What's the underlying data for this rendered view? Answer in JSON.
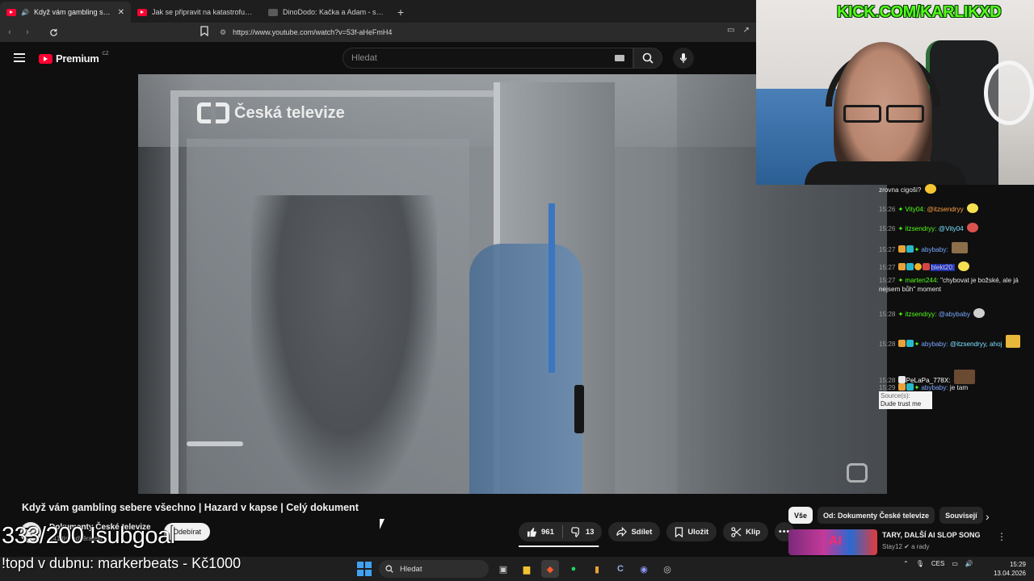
{
  "browser": {
    "tabs": [
      {
        "label": "Když vám gambling sebere v",
        "active": true
      },
      {
        "label": "Jak se připravit na katastrofu? | What",
        "active": false
      },
      {
        "label": "DinoDodo: Kačka a Adam - sourozen",
        "active": false
      }
    ],
    "new_tab": "+",
    "url": "https://www.youtube.com/watch?v=53f-aHeFmH4"
  },
  "youtube": {
    "logo_text": "Premium",
    "logo_region": "CZ",
    "search_placeholder": "Hledat",
    "video_watermark": "Česká televize",
    "video_corner_text": "ČESKÁ TELEVIZE",
    "video_title": "Když vám gambling sebere všechno | Hazard v kapse | Celý dokument",
    "channel_name": "Dokumenty České televize",
    "channel_subs": "141 tis. odběratelů",
    "subscribe_label": "Odebírat",
    "likes": "961",
    "dislikes": "13",
    "like_ratio": 0.99,
    "share_label": "Sdílet",
    "save_label": "Uložit",
    "clip_label": "Klip",
    "more_label": "•••",
    "chips": [
      "Vše",
      "Od: Dokumenty České televize",
      "Souvisejí"
    ],
    "chip_next": "›",
    "recommendation": {
      "title": "TARY, DALŠÍ AI SLOP SONG",
      "channel": "Stay12",
      "channel_suffix": "a rady",
      "thumb_text": "AI"
    }
  },
  "stream": {
    "kick_url": "KICK.COM/KARLIKXD",
    "subgoal": "333/200 !subgoal",
    "ticker": "!topd v dubnu: markerbeats - Kč1000",
    "chat": [
      {
        "ts": "",
        "user": "",
        "text": "zrovna cigoši?",
        "user_color": "#ffffff"
      },
      {
        "ts": "15:26",
        "user": "Vity04:",
        "text": "@itzsendryy",
        "user_color": "#53fc18",
        "mention_color": "#ff9f43"
      },
      {
        "ts": "15:26",
        "user": "itzsendryy:",
        "text": "@Vity04",
        "user_color": "#53fc18",
        "mention_color": "#7be0ff"
      },
      {
        "ts": "15:27",
        "user": "abybaby:",
        "text": "",
        "user_color": "#7aa8ff"
      },
      {
        "ts": "15:27",
        "user": "blekt20:",
        "text": "",
        "user_color": "#ffffff"
      },
      {
        "ts": "15:27",
        "user": "marten244:",
        "text": "\"chybovat je božské, ale já nejsem bůh\" moment",
        "user_color": "#53fc18"
      },
      {
        "ts": "15:28",
        "user": "itzsendryy:",
        "text": "@abybaby",
        "user_color": "#53fc18",
        "mention_color": "#7aa8ff"
      },
      {
        "ts": "15:28",
        "user": "abybaby:",
        "text": "@itzsendryy, ahoj",
        "user_color": "#7aa8ff",
        "mention_color": "#7be0ff"
      },
      {
        "ts": "15:28",
        "user": "PeLaPa_778X:",
        "text": "",
        "user_color": "#ffffff"
      },
      {
        "ts": "15:29",
        "user": "abybaby:",
        "text": "je tam",
        "user_color": "#7aa8ff"
      }
    ],
    "source_label": "Source(s):",
    "source_text": "Dude trust me"
  },
  "taskbar": {
    "search_placeholder": "Hledat",
    "language": "CES",
    "time": "15:29",
    "date": "13.04.2026"
  },
  "colors": {
    "yt_red": "#ff0033",
    "kick_green": "#53fc18",
    "bg": "#0f0f0f",
    "chip_bg": "#272727"
  }
}
